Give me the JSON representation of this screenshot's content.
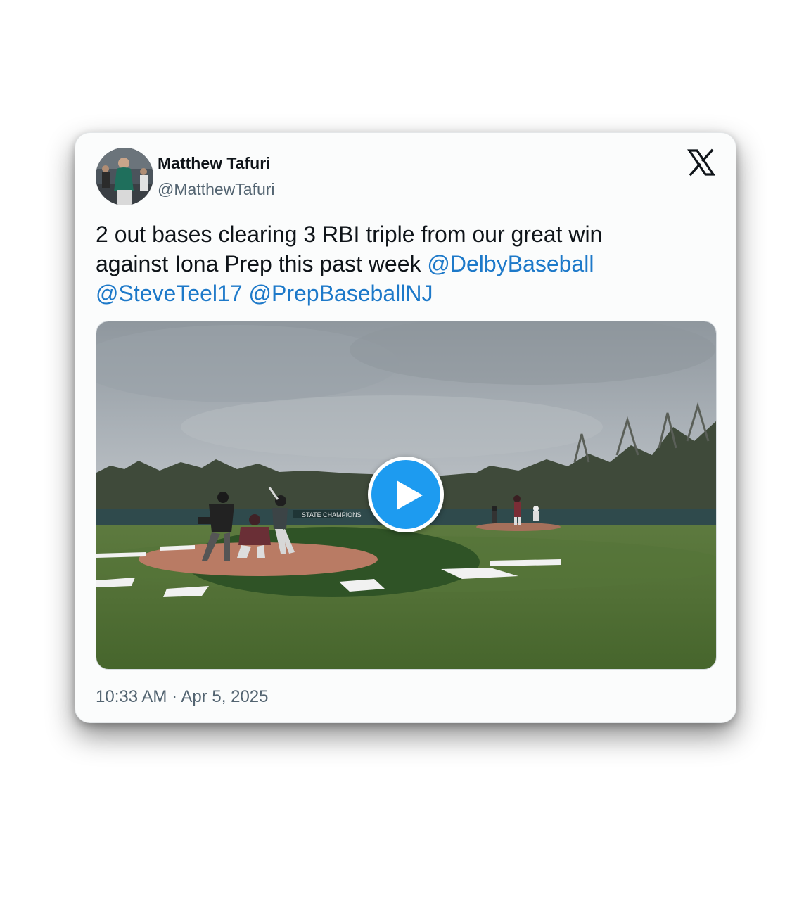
{
  "tweet": {
    "author_name": "Matthew Tafuri",
    "author_handle": "@MatthewTafuri",
    "text_line1": "2 out bases clearing 3 RBI triple from our great win",
    "text_line2_plain": "against Iona Prep this past week ",
    "mentions": [
      "@DelbyBaseball",
      "@SteveTeel17",
      "@PrepBaseballNJ"
    ],
    "timestamp": "10:33 AM · Apr 5, 2025"
  },
  "media": {
    "type": "video",
    "icon": "play-icon",
    "scene_banner_text": "STATE CHAMPIONS"
  },
  "icons": {
    "logo": "x-logo-icon",
    "avatar": "avatar"
  },
  "colors": {
    "mention": "#1d79c9",
    "play_button": "#1d9bf0",
    "text_primary": "#0f1419",
    "text_secondary": "#536471"
  }
}
